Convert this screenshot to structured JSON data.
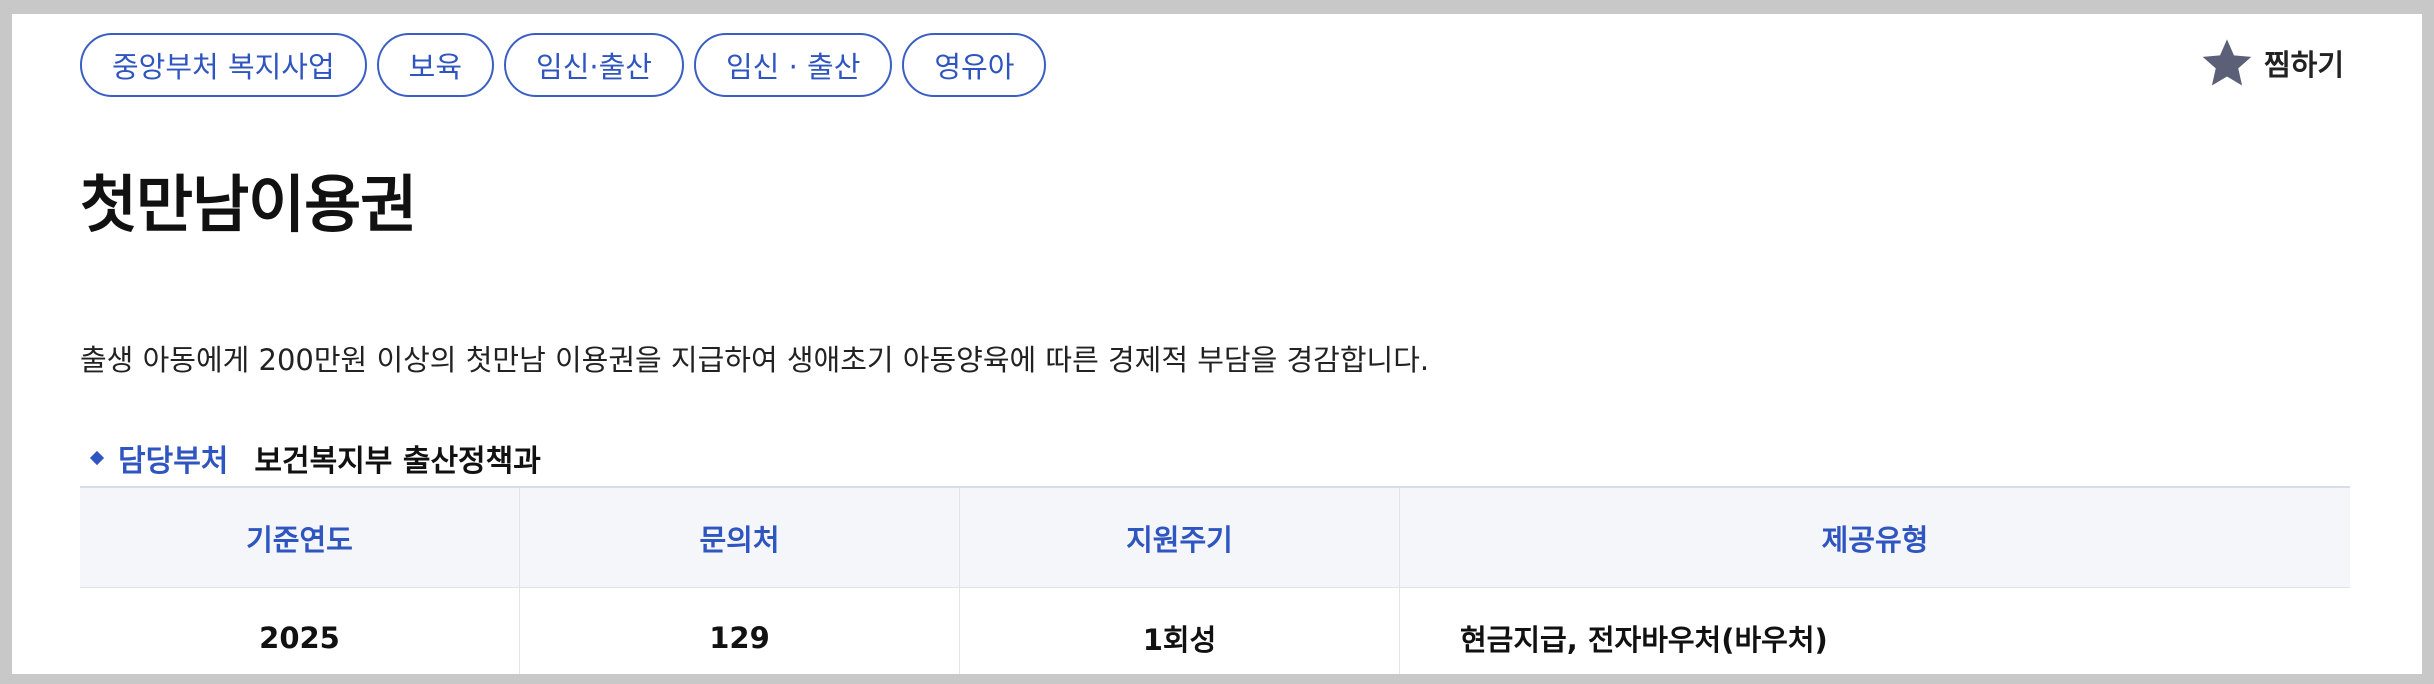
{
  "tags": [
    "중앙부처 복지사업",
    "보육",
    "임신·출산",
    "임신 · 출산",
    "영유아"
  ],
  "wishlist": {
    "label": "찜하기",
    "icon": "star-icon",
    "icon_color": "#5b6078"
  },
  "title": "첫만남이용권",
  "description": "출생 아동에게 200만원 이상의 첫만남 이용권을 지급하여 생애초기 아동양육에 따른 경제적 부담을 경감합니다.",
  "department": {
    "label": "담당부처",
    "value": "보건복지부 출산정책과"
  },
  "table": {
    "headers": [
      "기준연도",
      "문의처",
      "지원주기",
      "제공유형"
    ],
    "rows": [
      [
        "2025",
        "129",
        "1회성",
        "현금지급, 전자바우처(바우처)"
      ]
    ]
  },
  "colors": {
    "accent": "#2f55c0",
    "header_bg": "#f4f6fa"
  }
}
